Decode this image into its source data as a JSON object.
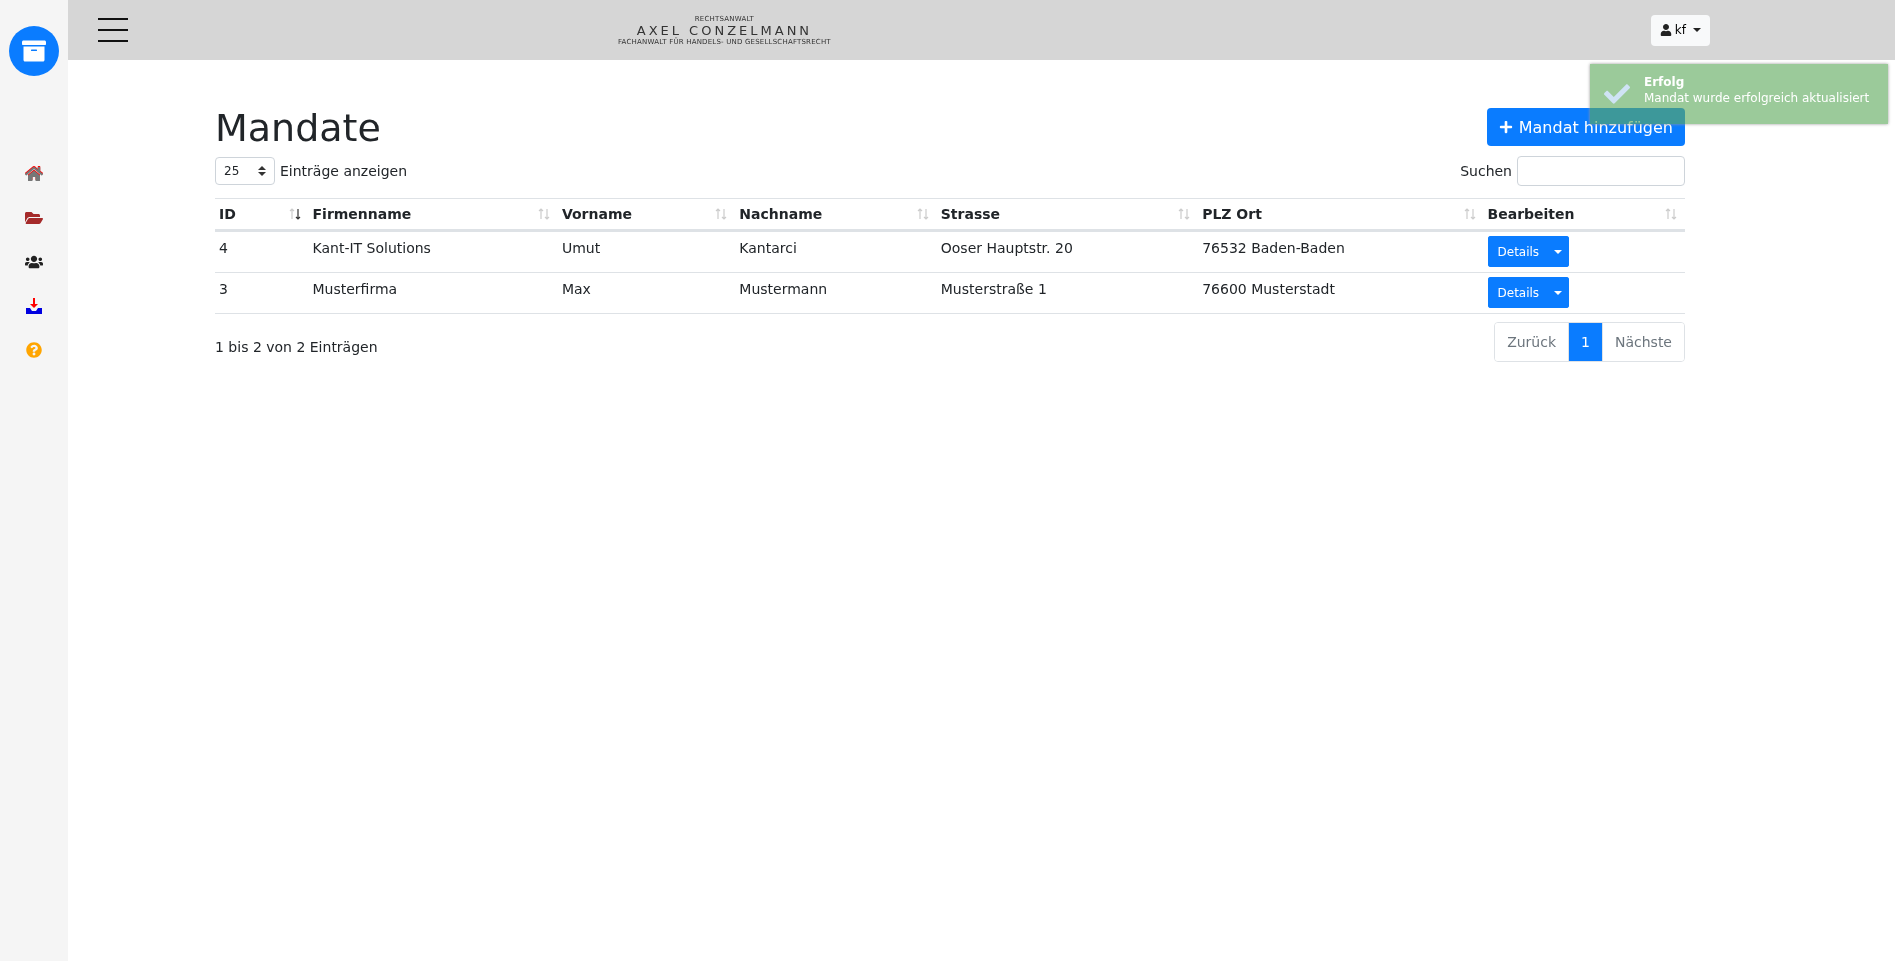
{
  "header": {
    "logo": {
      "top": "RECHTSANWALT",
      "name": "AXEL CONZELMANN",
      "sub": "FACHANWALT FÜR HANDELS- UND GESELLSCHAFTSRECHT"
    },
    "user": "kf"
  },
  "sidebar": {
    "items": [
      {
        "kind": "home"
      },
      {
        "kind": "folder"
      },
      {
        "kind": "users"
      },
      {
        "kind": "inbox"
      },
      {
        "kind": "help"
      }
    ]
  },
  "page": {
    "title": "Mandate",
    "add_button": "Mandat hinzufügen"
  },
  "length": {
    "value": "25",
    "label": "Einträge anzeigen"
  },
  "search": {
    "label": "Suchen"
  },
  "table": {
    "columns": [
      {
        "label": "ID",
        "sorted": true
      },
      {
        "label": "Firmenname",
        "sorted": false
      },
      {
        "label": "Vorname",
        "sorted": false
      },
      {
        "label": "Nachname",
        "sorted": false
      },
      {
        "label": "Strasse",
        "sorted": false
      },
      {
        "label": "PLZ Ort",
        "sorted": false
      },
      {
        "label": "Bearbeiten",
        "sorted": false
      }
    ],
    "rows": [
      {
        "cells": [
          "4",
          "Kant-IT Solutions",
          "Umut",
          "Kantarci",
          "Ooser Hauptstr. 20",
          "76532 Baden-Baden"
        ],
        "action": "Details"
      },
      {
        "cells": [
          "3",
          "Musterfirma",
          "Max",
          "Mustermann",
          "Musterstraße 1",
          "76600 Musterstadt"
        ],
        "action": "Details"
      }
    ]
  },
  "info": "1 bis 2 von 2 Einträgen",
  "pagination": [
    {
      "label": "Zurück",
      "selected": false
    },
    {
      "label": "1",
      "selected": true
    },
    {
      "label": "Nächste",
      "selected": false
    }
  ],
  "toast": {
    "title": "Erfolg",
    "message": "Mandat wurde erfolgreich aktualisiert"
  }
}
